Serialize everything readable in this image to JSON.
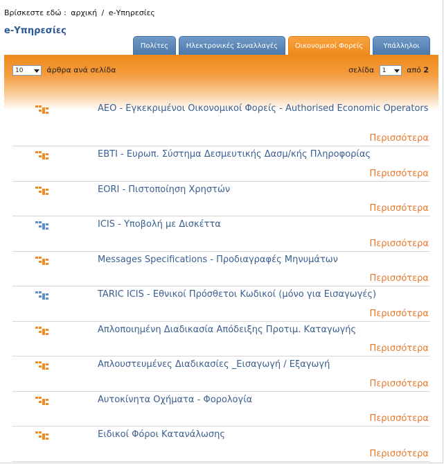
{
  "breadcrumb": {
    "prefix": "Βρίσκεστε εδώ :",
    "home": "αρχική",
    "sep": "/",
    "current": "e-Υπηρεσίες"
  },
  "page_title": "e-Υπηρεσίες",
  "tabs": [
    {
      "label": "Πολίτες",
      "active": false
    },
    {
      "label": "Ηλεκτρονικές Συναλλαγές",
      "active": false
    },
    {
      "label": "Οικονομικοί Φορείς",
      "active": true
    },
    {
      "label": "Υπάλληλοι",
      "active": false
    }
  ],
  "paging": {
    "per_page_value": "10",
    "per_page_label": "άρθρα ανά σελίδα",
    "page_label": "σελίδα",
    "page_value": "1",
    "of_label": "από",
    "total_pages": "2"
  },
  "more_label": "Περισσότερα",
  "colors": {
    "orange": "#f08a1c",
    "blue": "#4d79ab",
    "link": "#3a5f8f",
    "more": "#e8772a"
  },
  "items": [
    {
      "title": "AEO - Εγκεκριμένοι Οικονομικοί Φορείς - Authorised Economic Operators",
      "icon": "orange"
    },
    {
      "title": "EBTI - Ευρωπ. Σύστημα Δεσμευτικής Δασμ/κής Πληροφορίας",
      "icon": "orange"
    },
    {
      "title": "EORI - Πιστοποίηση Χρηστών",
      "icon": "orange"
    },
    {
      "title": "ICIS - Υποβολή με Δισκέττα",
      "icon": "blue"
    },
    {
      "title": "Messages Specifications - Προδιαγραφές Μηνυμάτων",
      "icon": "orange"
    },
    {
      "title": "TARIC ICIS - Εθνικοί Πρόσθετοι Κωδικοί (μόνο για Εισαγωγές)",
      "icon": "blue"
    },
    {
      "title": "Απλοποιημένη Διαδικασία Απόδειξης Προτιμ. Καταγωγής",
      "icon": "orange"
    },
    {
      "title": "Απλουστευμένες Διαδικασίες _Εισαγωγή / Εξαγωγή",
      "icon": "orange"
    },
    {
      "title": "Αυτοκίνητα Οχήματα - Φορολογία",
      "icon": "orange"
    },
    {
      "title": "Ειδικοί Φόροι Κατανάλωσης",
      "icon": "orange"
    }
  ]
}
